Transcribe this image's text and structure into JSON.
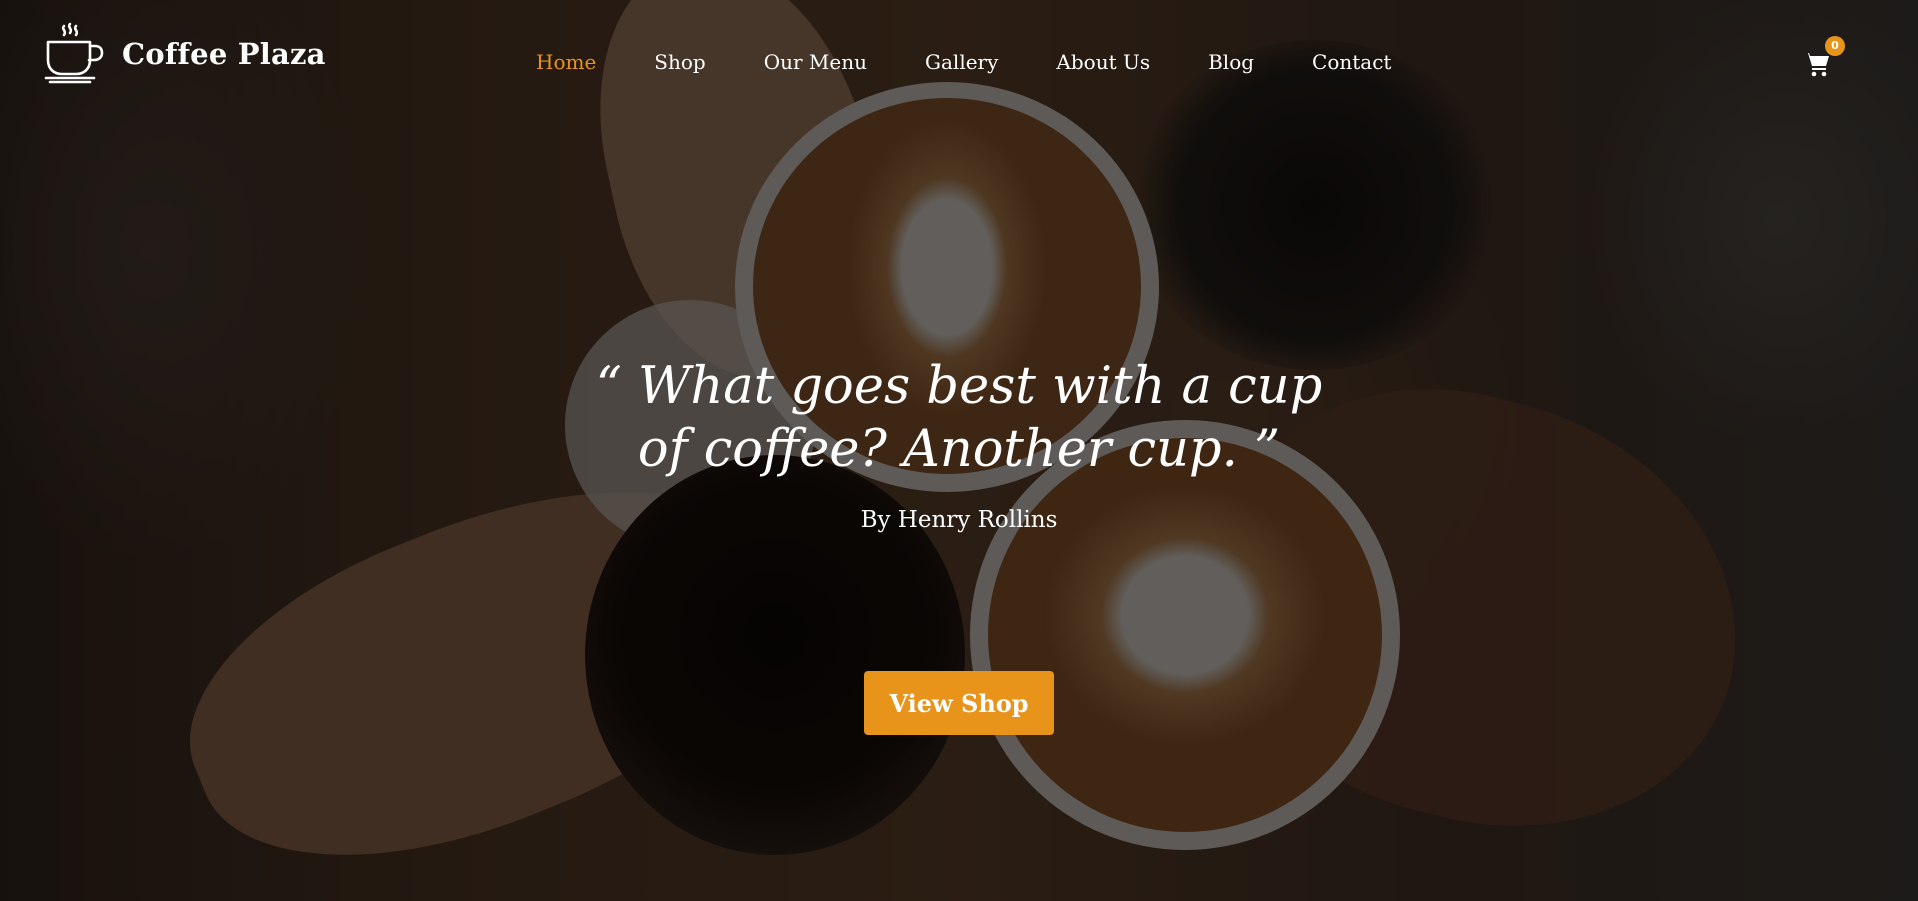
{
  "brand": {
    "name": "Coffee Plaza",
    "logo_icon": "coffee-cup-icon"
  },
  "nav": {
    "items": [
      {
        "label": "Home",
        "active": true
      },
      {
        "label": "Shop",
        "active": false
      },
      {
        "label": "Our Menu",
        "active": false
      },
      {
        "label": "Gallery",
        "active": false
      },
      {
        "label": "About Us",
        "active": false
      },
      {
        "label": "Blog",
        "active": false
      },
      {
        "label": "Contact",
        "active": false
      }
    ]
  },
  "cart": {
    "icon": "shopping-cart-icon",
    "count": "0"
  },
  "hero": {
    "quote": "“ What goes best with a cup of coffee? Another cup. ”",
    "author": "By Henry Rollins",
    "cta_label": "View Shop",
    "background_image": "overhead photo of hands toasting two latte-art coffees and an iced coffee"
  },
  "colors": {
    "accent": "#e8941a",
    "text": "#ffffff",
    "overlay": "rgba(0,0,0,0.6)"
  }
}
